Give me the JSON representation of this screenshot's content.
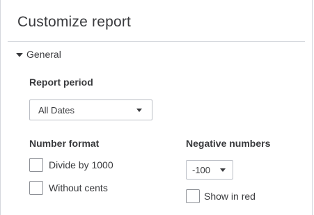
{
  "panel": {
    "title": "Customize report"
  },
  "general_section": {
    "label": "General",
    "expanded": true
  },
  "report_period": {
    "label": "Report period",
    "selected": "All Dates"
  },
  "number_format": {
    "label": "Number format",
    "divide_by_1000": {
      "label": "Divide by 1000",
      "checked": false
    },
    "without_cents": {
      "label": "Without cents",
      "checked": false
    }
  },
  "negative_numbers": {
    "label": "Negative numbers",
    "selected": "-100",
    "show_in_red": {
      "label": "Show in red",
      "checked": false
    }
  },
  "icons": {
    "section_toggle": "caret-down-icon",
    "dropdown_arrow": "chevron-down-icon"
  },
  "colors": {
    "text": "#393a3d",
    "border": "#babec5",
    "divider": "#d4d7dc"
  }
}
